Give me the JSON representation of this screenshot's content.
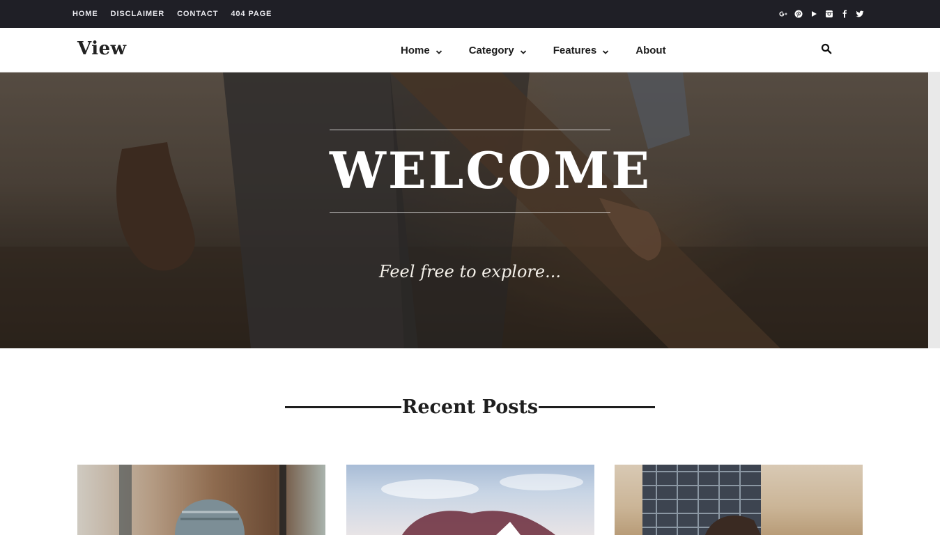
{
  "topbar": {
    "links": [
      "HOME",
      "DISCLAIMER",
      "CONTACT",
      "404 PAGE"
    ],
    "social_icons": [
      "google-plus-icon",
      "pinterest-icon",
      "youtube-icon",
      "instagram-icon",
      "facebook-icon",
      "twitter-icon"
    ]
  },
  "header": {
    "logo": "View",
    "nav": [
      {
        "label": "Home",
        "has_dropdown": true
      },
      {
        "label": "Category",
        "has_dropdown": true
      },
      {
        "label": "Features",
        "has_dropdown": true
      },
      {
        "label": "About",
        "has_dropdown": false
      }
    ],
    "search_icon": "search-icon"
  },
  "hero": {
    "title": "WELCOME",
    "tagline": "Feel free to explore..."
  },
  "recent": {
    "title": "Recent Posts"
  },
  "colors": {
    "topbar_bg": "#1f1f26",
    "text_dark": "#1e1e1e",
    "white": "#ffffff"
  }
}
